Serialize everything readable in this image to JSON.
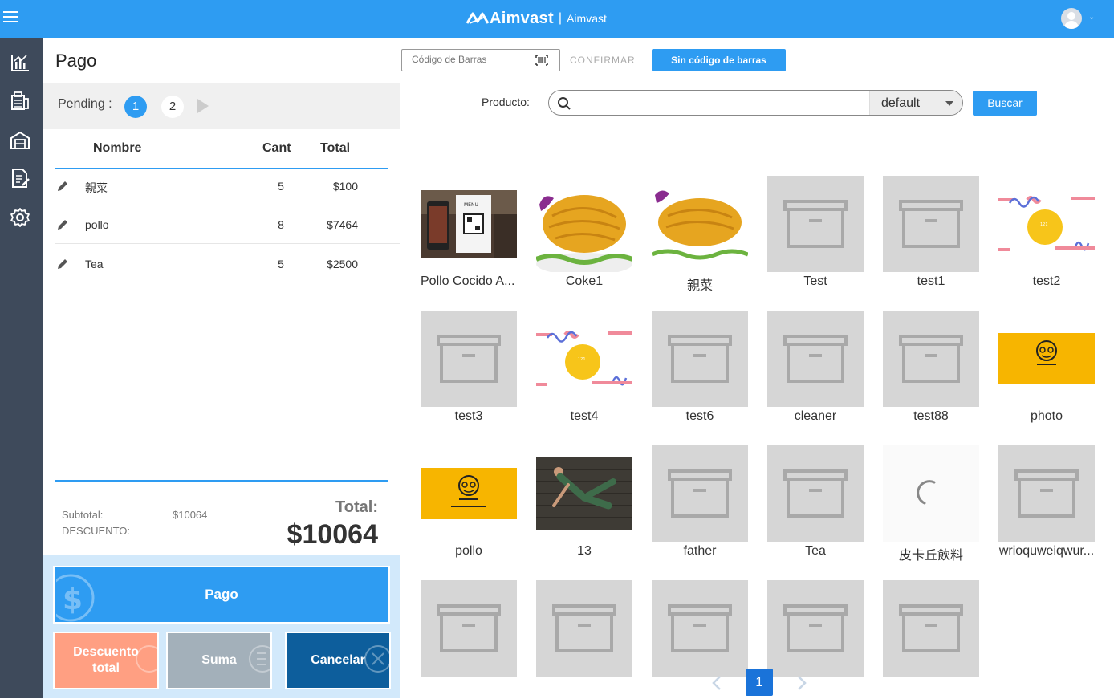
{
  "header": {
    "brand": "Aimvast",
    "separator": "|",
    "subtitle": "Aimvast",
    "menu_icon": "hamburger-icon",
    "avatar_icon": "user-avatar-icon",
    "caret": "⌄"
  },
  "sidebar": {
    "items": [
      {
        "icon": "chart-icon"
      },
      {
        "icon": "register-icon"
      },
      {
        "icon": "store-icon"
      },
      {
        "icon": "document-edit-icon"
      },
      {
        "icon": "gear-icon"
      }
    ]
  },
  "left": {
    "title": "Pago",
    "pending_label": "Pending :",
    "pending_tabs": [
      "1",
      "2"
    ],
    "columns": {
      "name": "Nombre",
      "qty": "Cant",
      "total": "Total"
    },
    "rows": [
      {
        "name": "親菜",
        "qty": "5",
        "total": "$100"
      },
      {
        "name": "pollo",
        "qty": "8",
        "total": "$7464"
      },
      {
        "name": "Tea",
        "qty": "5",
        "total": "$2500"
      }
    ],
    "subtotal_label": "Subtotal:",
    "subtotal_value": "$10064",
    "discount_label": "DESCUENTO:",
    "total_label": "Total:",
    "total_value": "$10064",
    "buttons": {
      "pago": "Pago",
      "descuento": "Descuento total",
      "suma": "Suma",
      "cancelar": "Cancelar"
    }
  },
  "toolbar": {
    "barcode_placeholder": "Código de Barras",
    "confirm": "CONFIRMAR",
    "no_barcode": "Sin código de barras",
    "product_label": "Producto:",
    "search_value": "",
    "select_value": "default",
    "search_button": "Buscar"
  },
  "products": [
    {
      "name": "Pollo Cocido A...",
      "image": "qr-menu"
    },
    {
      "name": "Coke1",
      "image": "chicken"
    },
    {
      "name": "親菜",
      "image": "chicken-small"
    },
    {
      "name": "Test",
      "image": "placeholder"
    },
    {
      "name": "test1",
      "image": "placeholder"
    },
    {
      "name": "test2",
      "image": "pollo-logo-light"
    },
    {
      "name": "test3",
      "image": "placeholder"
    },
    {
      "name": "test4",
      "image": "pollo-logo-light"
    },
    {
      "name": "test6",
      "image": "placeholder"
    },
    {
      "name": "cleaner",
      "image": "placeholder"
    },
    {
      "name": "test88",
      "image": "placeholder"
    },
    {
      "name": "photo",
      "image": "pollo-logo-yellow"
    },
    {
      "name": "pollo",
      "image": "pollo-logo-yellow"
    },
    {
      "name": "13",
      "image": "yoga"
    },
    {
      "name": "father",
      "image": "placeholder"
    },
    {
      "name": "Tea",
      "image": "placeholder"
    },
    {
      "name": "皮卡丘飲料",
      "image": "loading"
    },
    {
      "name": "wrioquweiqwur...",
      "image": "placeholder"
    },
    {
      "name": "",
      "image": "placeholder"
    },
    {
      "name": "",
      "image": "placeholder"
    },
    {
      "name": "",
      "image": "placeholder"
    },
    {
      "name": "",
      "image": "placeholder"
    },
    {
      "name": "",
      "image": "placeholder"
    }
  ],
  "pagination": {
    "current": "1"
  },
  "colors": {
    "accent": "#2e9cf2",
    "sidebar": "#3e4a5b",
    "desc": "#ff9f82",
    "suma": "#a3b0ba",
    "cancel": "#0d5e9c"
  }
}
